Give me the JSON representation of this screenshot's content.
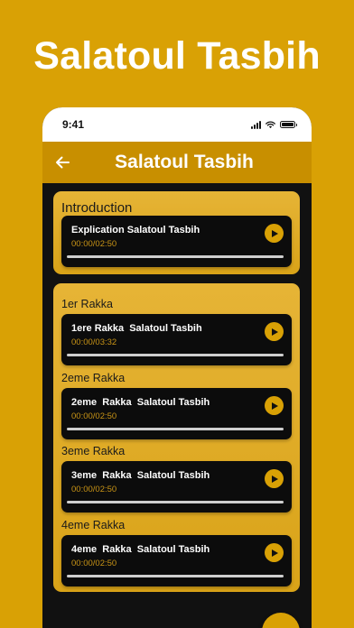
{
  "promo": {
    "title": "Salatoul Tasbih"
  },
  "status_bar": {
    "time": "9:41"
  },
  "app_bar": {
    "title": "Salatoul Tasbih"
  },
  "intro_section": {
    "heading": "Introduction",
    "track": {
      "title": "Explication Salatoul Tasbih",
      "time": "00:00/02:50",
      "progress": 0
    }
  },
  "rakka_section": {
    "groups": [
      {
        "label": "1er Rakka",
        "track": {
          "title": "1ere Rakka  Salatoul Tasbih",
          "time": "00:00/03:32",
          "progress": 0
        }
      },
      {
        "label": "2eme Rakka",
        "track": {
          "title": "2eme  Rakka  Salatoul Tasbih",
          "time": "00:00/02:50",
          "progress": 0
        }
      },
      {
        "label": "3eme  Rakka",
        "track": {
          "title": "3eme  Rakka  Salatoul Tasbih",
          "time": "00:00/02:50",
          "progress": 0
        }
      },
      {
        "label": "4eme  Rakka",
        "track": {
          "title": "4eme  Rakka  Salatoul Tasbih",
          "time": "00:00/02:50",
          "progress": 0
        }
      }
    ]
  },
  "icons": {
    "back": "arrow-left-icon",
    "play": "play-icon",
    "signal": "cellular-signal-icon",
    "wifi": "wifi-icon",
    "battery": "battery-icon"
  },
  "colors": {
    "background": "#D9A105",
    "app_bar": "#C88F00",
    "card": "#0c0c0c",
    "accent": "#D9A105",
    "time_text": "#C99416"
  }
}
